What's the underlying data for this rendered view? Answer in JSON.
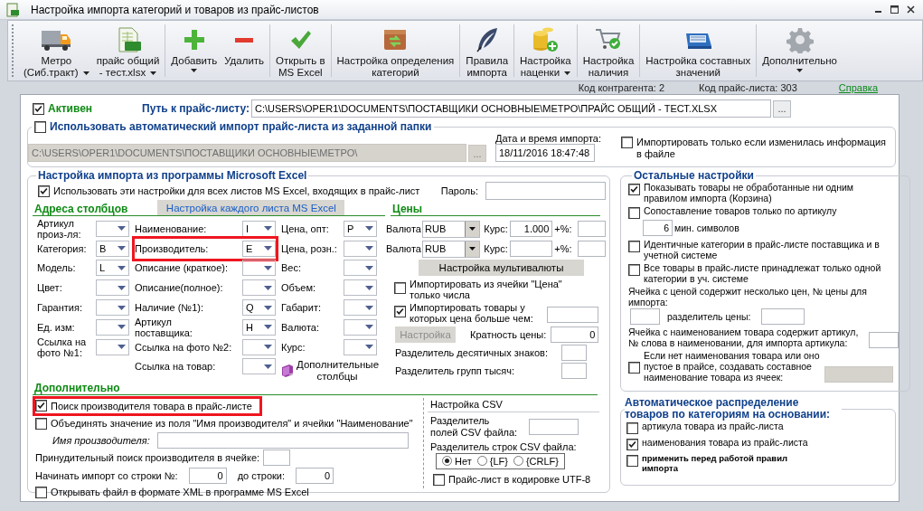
{
  "window": {
    "title": "Настройка импорта категорий и товаров из прайс-листов"
  },
  "toolbar": {
    "groups": [
      [
        {
          "lines": [
            "Метро",
            "(Сиб.тракт)"
          ],
          "dropdown": true
        },
        {
          "lines": [
            "прайс общий",
            "- тест.xlsx"
          ],
          "dropdown": true
        }
      ],
      [
        {
          "lines": [
            "Добавить"
          ],
          "dropdown": true
        },
        {
          "lines": [
            "Удалить"
          ],
          "dropdown": false
        }
      ],
      [
        {
          "lines": [
            "Открыть в",
            "MS Excel"
          ],
          "dropdown": false
        }
      ],
      [
        {
          "lines": [
            "Настройка определения",
            "категорий"
          ],
          "dropdown": false
        }
      ],
      [
        {
          "lines": [
            "Правила",
            "импорта"
          ],
          "dropdown": false
        }
      ],
      [
        {
          "lines": [
            "Настройка",
            "наценки"
          ],
          "dropdown": true
        }
      ],
      [
        {
          "lines": [
            "Настройка",
            "наличия"
          ],
          "dropdown": false
        }
      ],
      [
        {
          "lines": [
            "Настройка составных",
            "значений"
          ],
          "dropdown": false
        }
      ],
      [
        {
          "lines": [
            "Дополнительно"
          ],
          "dropdown": true
        }
      ]
    ]
  },
  "info_bar": {
    "contractor_code": "Код контрагента: 2",
    "pricelist_code": "Код прайс-листа: 303",
    "help_link": "Справка"
  },
  "general": {
    "active": {
      "label": "Активен",
      "checked": true
    },
    "path_label": "Путь к прайс-листу:",
    "path_value": "C:\\USERS\\OPER1\\DOCUMENTS\\ПОСТАВЩИКИ ОСНОВНЫЕ\\МЕТРО\\ПРАЙС ОБЩИЙ - ТЕСТ.XLSX",
    "browse": "..."
  },
  "auto_import": {
    "label": "Использовать автоматический импорт прайс-листа из заданной папки",
    "checked": false,
    "folder_value": "C:\\USERS\\OPER1\\DOCUMENTS\\ПОСТАВЩИКИ ОСНОВНЫЕ\\МЕТРО\\",
    "browse": "...",
    "date_label": "Дата и время импорта:",
    "date_value": "18/11/2016 18:47:48",
    "only_changed": {
      "label": "Импортировать только если изменилась информация в файле",
      "checked": false
    }
  },
  "excel": {
    "title": "Настройка импорта из программы Microsoft Excel",
    "all_sheets": {
      "label": "Использовать эти настройки для всех листов MS Excel, входящих в прайс-лист",
      "checked": true
    },
    "password_label": "Пароль:",
    "columns_title": "Адреса столбцов",
    "per_sheet_button": "Настройка каждого листа MS Excel",
    "prices_title": "Цены",
    "columns": [
      [
        {
          "label": "Артикул произ-ля:",
          "highlighted": false
        },
        {
          "label": "Категория:",
          "value": "B",
          "highlighted": false
        },
        {
          "label": "Модель:",
          "value": "L",
          "highlighted": false
        },
        {
          "label": "Цвет:",
          "highlighted": false
        },
        {
          "label": "Гарантия:",
          "highlighted": false
        },
        {
          "label": "Ед. изм:",
          "highlighted": false
        },
        {
          "label": "Ссылка на фото №1:",
          "highlighted": false
        }
      ],
      [
        {
          "label": "Наименование:",
          "value": "I",
          "highlighted": false
        },
        {
          "label": "Производитель:",
          "value": "E",
          "highlighted": true
        },
        {
          "label": "Описание (краткое):",
          "highlighted": false
        },
        {
          "label": "Описание(полное):",
          "highlighted": false
        },
        {
          "label": "Наличие (№1):",
          "value": "Q",
          "highlighted": false
        },
        {
          "label": "Артикул\nпоставщика:",
          "value": "H",
          "highlighted": false
        },
        {
          "label": "Ссылка на фото №2:",
          "highlighted": false
        },
        {
          "label": "Ссылка на товар:",
          "highlighted": false
        }
      ],
      [
        {
          "label": "Цена, опт:",
          "value": "P",
          "highlighted": false
        },
        {
          "label": "Цена, розн.:",
          "highlighted": false
        },
        {
          "label": "Вес:",
          "highlighted": false
        },
        {
          "label": "Объем:",
          "highlighted": false
        },
        {
          "label": "Габарит:",
          "highlighted": false
        },
        {
          "label": "Валюта:",
          "highlighted": false
        },
        {
          "label": "Курс:",
          "highlighted": false
        }
      ]
    ],
    "extra_columns_button": "Дополнительные столбцы",
    "prices": {
      "currencies": [
        {
          "label": "Валюта:",
          "value": "RUB",
          "rate_label": "Курс:",
          "rate": "1.000",
          "markup_label": "+%:"
        },
        {
          "label": "Валюта:",
          "value": "RUB",
          "rate_label": "Курс:",
          "markup_label": "+%:"
        }
      ],
      "multicurrency_button": "Настройка мультивалюты",
      "numbers_only": {
        "label": "Импортировать из ячейки \"Цена\" только числа",
        "checked": false
      },
      "min_price": {
        "label": "Импортировать товары у которых цена больше чем:",
        "checked": true
      },
      "settings_button": {
        "label": "Настройка",
        "disabled": true
      },
      "multiplicity_label": "Кратность цены:",
      "multiplicity": "0",
      "decimal_label": "Разделитель десятичных знаков:",
      "thousands_label": "Разделитель групп тысяч:"
    },
    "additional": {
      "title": "Дополнительно",
      "find_manufacturer": {
        "label": "Поиск производителя товара в прайс-листе",
        "checked": true,
        "highlighted": true
      },
      "merge": {
        "label": "Объединять значение из поля \"Имя производителя\" и ячейки \"Наименование\"",
        "checked": false
      },
      "manufacturer_name_label": "Имя производителя:",
      "forced_search_label": "Принудительный поиск производителя в ячейке:",
      "start_row_label": "Начинать импорт со строки №:",
      "start_row": "0",
      "end_row_label": "до строки:",
      "end_row": "0",
      "open_xml": {
        "label": "Открывать файл в формате XML в программе MS Excel",
        "checked": false
      }
    },
    "csv": {
      "title": "Настройка CSV",
      "field_separator_label": "Разделитель\nполей CSV файла:",
      "row_separator_label": "Разделитель строк CSV файла:",
      "row_separators": [
        {
          "label": "Нет",
          "selected": true
        },
        {
          "label": "{LF}",
          "selected": false
        },
        {
          "label": "{CRLF}",
          "selected": false
        }
      ],
      "utf8": {
        "label": "Прайс-лист в кодировке UTF-8",
        "checked": false
      }
    }
  },
  "other": {
    "title": "Остальные настройки",
    "items": [
      {
        "kind": "checkbox",
        "label": "Показывать товары не обработанные ни одним правилом импорта (Корзина)",
        "checked": true
      },
      {
        "kind": "checkbox_min",
        "label": "Сопоставление товаров только по артикулу",
        "checked": false,
        "min_length": "6",
        "min_length_label": "мин. символов"
      },
      {
        "kind": "checkbox",
        "label": "Идентичные категории в прайс-листе поставщика и в учетной системе",
        "checked": false
      },
      {
        "kind": "checkbox",
        "label": "Все товары в прайс-листе принадлежат только одной категории в уч. системе",
        "checked": false
      },
      {
        "kind": "price_split",
        "label": "Ячейка с ценой содержит несколько цен, № цены для импорта:",
        "separator_label": "разделитель цены:"
      },
      {
        "kind": "word_index",
        "label": "Ячейка с наименованием товара содержит артикул, № слова в наименовании, для импорта артикула:"
      },
      {
        "kind": "composite",
        "label": "Если нет наименования товара или оно пустое в прайсе, создавать составное наименование товара из ячеек:",
        "checked": false
      }
    ]
  },
  "auto_distribution": {
    "title": "Автоматическое распределение товаров по категориям на основании:",
    "items": [
      {
        "kind": "option",
        "label": "артикула товара из прайс-листа",
        "checked": false
      },
      {
        "kind": "option",
        "label": "наименования товара из прайс-листа",
        "checked": true
      },
      {
        "kind": "sub_option",
        "label": "применить перед работой правил импорта",
        "checked": false
      }
    ]
  }
}
